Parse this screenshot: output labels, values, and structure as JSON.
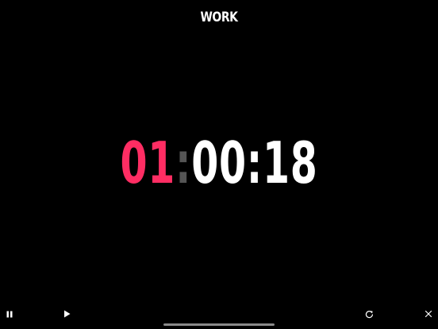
{
  "header": {
    "title": "WORK"
  },
  "timer": {
    "round": "01",
    "separator": ":",
    "time": "00:18"
  },
  "controls": {
    "pause_icon": "pause-icon",
    "play_icon": "play-icon",
    "restart_icon": "restart-icon",
    "close_icon": "close-icon"
  },
  "colors": {
    "background": "#000000",
    "accent": "#ff2d63",
    "separator": "#555555",
    "text": "#ffffff"
  }
}
